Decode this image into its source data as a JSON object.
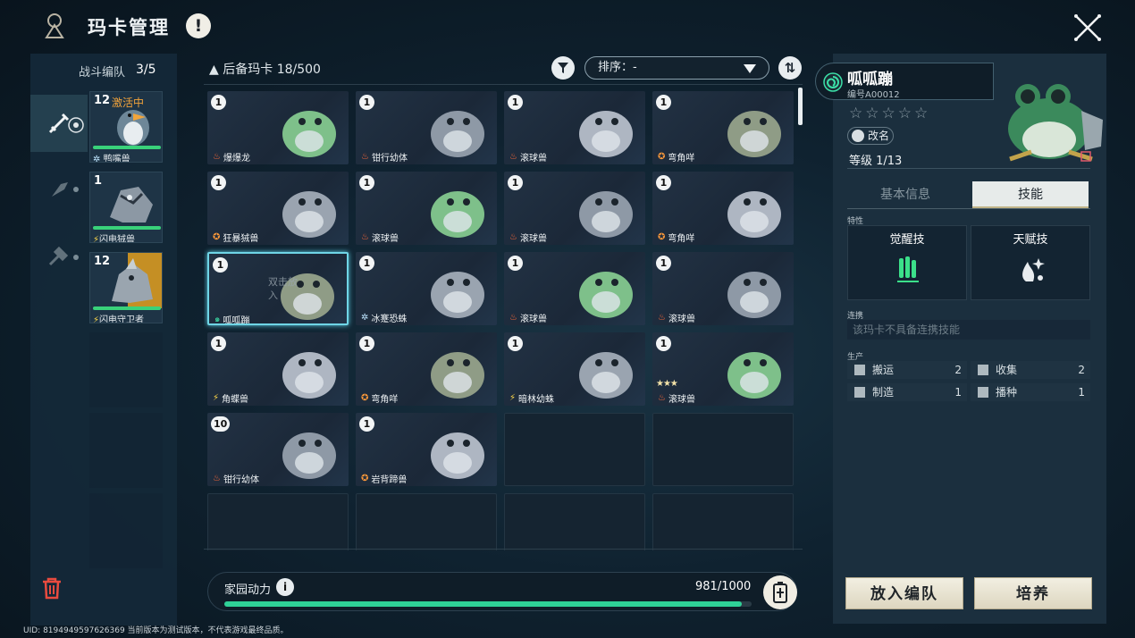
{
  "header": {
    "title": "玛卡管理",
    "alert_icon": "exclamation-icon",
    "close_icon": "close-icon"
  },
  "team": {
    "label": "战斗编队",
    "count": "3/5",
    "members": [
      {
        "level": "12",
        "status": "激活中",
        "name": "鸭嘴兽",
        "element": "ice"
      },
      {
        "level": "1",
        "status": "",
        "name": "闪电狨兽",
        "element": "electric"
      },
      {
        "level": "12",
        "status": "",
        "name": "闪电守卫者",
        "element": "electric"
      }
    ]
  },
  "reserve": {
    "label": "后备玛卡",
    "count": "18/500"
  },
  "sort": {
    "label": "排序：-"
  },
  "grid": [
    {
      "level": "1",
      "name": "爆爆龙",
      "element": "fire",
      "stars": ""
    },
    {
      "level": "1",
      "name": "钳行幼体",
      "element": "fire",
      "stars": ""
    },
    {
      "level": "1",
      "name": "滚球兽",
      "element": "fire",
      "stars": ""
    },
    {
      "level": "1",
      "name": "弯角咩",
      "element": "earth",
      "stars": ""
    },
    {
      "level": "1",
      "name": "狂暴狨兽",
      "element": "earth",
      "stars": ""
    },
    {
      "level": "1",
      "name": "滚球兽",
      "element": "fire",
      "stars": ""
    },
    {
      "level": "1",
      "name": "滚球兽",
      "element": "fire",
      "stars": ""
    },
    {
      "level": "1",
      "name": "弯角咩",
      "element": "earth",
      "stars": ""
    },
    {
      "level": "1",
      "name": "呱呱蹦",
      "element": "wind",
      "stars": "",
      "selected": true,
      "hint": "双击放入"
    },
    {
      "level": "1",
      "name": "冰蹇恐蛛",
      "element": "ice",
      "stars": ""
    },
    {
      "level": "1",
      "name": "滚球兽",
      "element": "fire",
      "stars": ""
    },
    {
      "level": "1",
      "name": "滚球兽",
      "element": "fire",
      "stars": ""
    },
    {
      "level": "1",
      "name": "角蝶兽",
      "element": "electric",
      "stars": ""
    },
    {
      "level": "1",
      "name": "弯角咩",
      "element": "earth",
      "stars": ""
    },
    {
      "level": "1",
      "name": "暗林幼蛛",
      "element": "electric",
      "stars": ""
    },
    {
      "level": "1",
      "name": "滚球兽",
      "element": "fire",
      "stars": "★★★"
    },
    {
      "level": "10",
      "name": "钳行幼体",
      "element": "fire",
      "stars": ""
    },
    {
      "level": "1",
      "name": "岩背蹄兽",
      "element": "earth",
      "stars": ""
    }
  ],
  "energy": {
    "label": "家园动力",
    "value": "981/1000",
    "fraction": 0.981
  },
  "uid_text": "UID: 8194949597626369 当前版本为测试版本，不代表游戏最终品质。",
  "detail": {
    "name": "呱呱蹦",
    "id": "编号A00012",
    "stars": "☆☆☆☆☆",
    "rename": "改名",
    "level": "等级 1/13",
    "tabs": [
      "基本信息",
      "技能"
    ],
    "active_tab": 1,
    "trait_label": "特性",
    "skills": [
      {
        "name": "觉醒技",
        "icon": "awaken-skill-icon"
      },
      {
        "name": "天赋技",
        "icon": "talent-skill-icon"
      }
    ],
    "link_label": "连携",
    "link_text": "该玛卡不具备连携技能",
    "prod_label": "生产",
    "production": [
      {
        "name": "搬运",
        "value": "2",
        "icon": "box-icon"
      },
      {
        "name": "收集",
        "value": "2",
        "icon": "basket-icon"
      },
      {
        "name": "制造",
        "value": "1",
        "icon": "hammer-icon"
      },
      {
        "name": "播种",
        "value": "1",
        "icon": "sprout-icon"
      }
    ],
    "buttons": {
      "team": "放入编队",
      "train": "培养"
    }
  },
  "colors": {
    "fire": "#ff6a3a",
    "ice": "#bfe6ff",
    "electric": "#ffd84a",
    "earth": "#ff9a3a",
    "wind": "#3be0a8",
    "accent": "#2fd197"
  }
}
